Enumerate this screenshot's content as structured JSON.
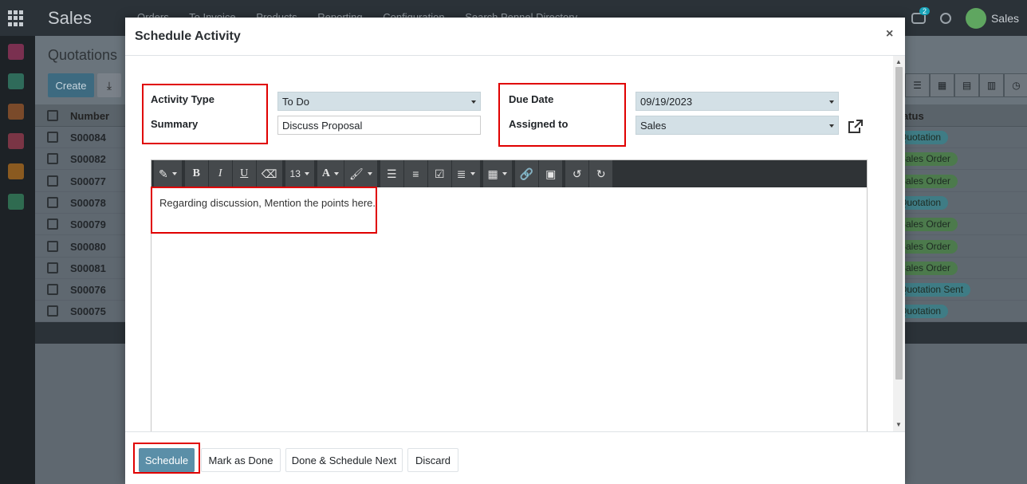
{
  "app": {
    "brand": "Sales",
    "menu": [
      "Orders",
      "To Invoice",
      "Products",
      "Reporting",
      "Configuration",
      "Search Pennel Directory"
    ],
    "chat_count": "2",
    "user": "Sales"
  },
  "page": {
    "title": "Quotations",
    "create_label": "Create",
    "columns": {
      "number": "Number",
      "status": "Status"
    },
    "rows": [
      {
        "number": "S00084",
        "status": "Quotation",
        "kind": "q"
      },
      {
        "number": "S00082",
        "status": "Sales Order",
        "kind": "so"
      },
      {
        "number": "S00077",
        "status": "Sales Order",
        "kind": "so"
      },
      {
        "number": "S00078",
        "status": "Quotation",
        "kind": "q"
      },
      {
        "number": "S00079",
        "status": "Sales Order",
        "kind": "so"
      },
      {
        "number": "S00080",
        "status": "Sales Order",
        "kind": "so"
      },
      {
        "number": "S00081",
        "status": "Sales Order",
        "kind": "so"
      },
      {
        "number": "S00076",
        "status": "Quotation Sent",
        "kind": "q"
      },
      {
        "number": "S00075",
        "status": "Quotation",
        "kind": "q"
      }
    ]
  },
  "dialog": {
    "title": "Schedule Activity",
    "close": "×",
    "activity_type_label": "Activity Type",
    "activity_type_value": "To Do",
    "summary_label": "Summary",
    "summary_value": "Discuss Proposal",
    "due_date_label": "Due Date",
    "due_date_value": "09/19/2023",
    "assigned_to_label": "Assigned to",
    "assigned_to_value": "Sales",
    "font_size": "13",
    "note": "Regarding discussion, Mention the points here.",
    "buttons": {
      "schedule": "Schedule",
      "mark_done": "Mark as Done",
      "done_next": "Done & Schedule Next",
      "discard": "Discard"
    }
  },
  "colors": {
    "highlight": "#e00000",
    "primary": "#5b8fa8",
    "navbar": "#2b3238"
  }
}
